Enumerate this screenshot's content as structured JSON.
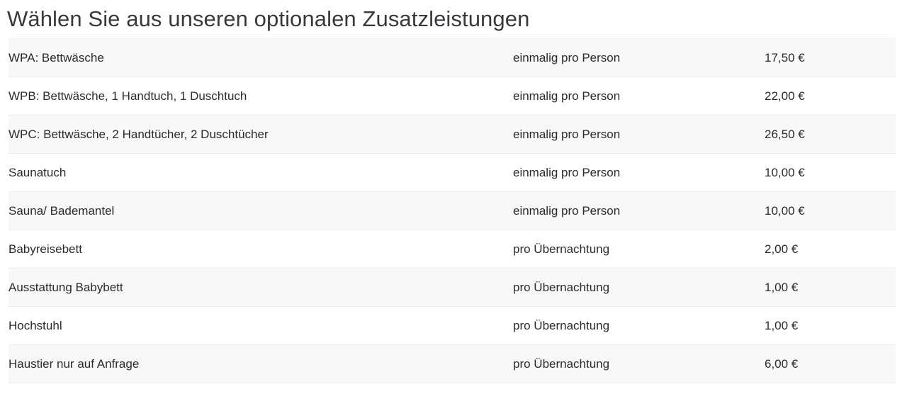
{
  "heading": "Wählen Sie aus unseren optionalen Zusatzleistungen",
  "theme": {
    "page_background": "#ffffff",
    "stripe_background": "#f8f8f9",
    "row_border": "#ececee",
    "heading_color": "#36393d",
    "text_color": "#2b2b2b"
  },
  "services_table": {
    "columns": [
      "service",
      "unit",
      "price"
    ],
    "rows": [
      {
        "service": "WPA: Bettwäsche",
        "unit": "einmalig pro Person",
        "price": "17,50 €"
      },
      {
        "service": "WPB: Bettwäsche, 1 Handtuch, 1 Duschtuch",
        "unit": "einmalig pro Person",
        "price": "22,00 €"
      },
      {
        "service": "WPC: Bettwäsche, 2 Handtücher, 2 Duschtücher",
        "unit": "einmalig pro Person",
        "price": "26,50 €"
      },
      {
        "service": "Saunatuch",
        "unit": "einmalig pro Person",
        "price": "10,00 €"
      },
      {
        "service": "Sauna/ Bademantel",
        "unit": "einmalig pro Person",
        "price": "10,00 €"
      },
      {
        "service": "Babyreisebett",
        "unit": "pro Übernachtung",
        "price": "2,00 €"
      },
      {
        "service": "Ausstattung Babybett",
        "unit": "pro Übernachtung",
        "price": "1,00 €"
      },
      {
        "service": "Hochstuhl",
        "unit": "pro Übernachtung",
        "price": "1,00 €"
      },
      {
        "service": "Haustier nur auf Anfrage",
        "unit": "pro Übernachtung",
        "price": "6,00 €"
      }
    ]
  }
}
